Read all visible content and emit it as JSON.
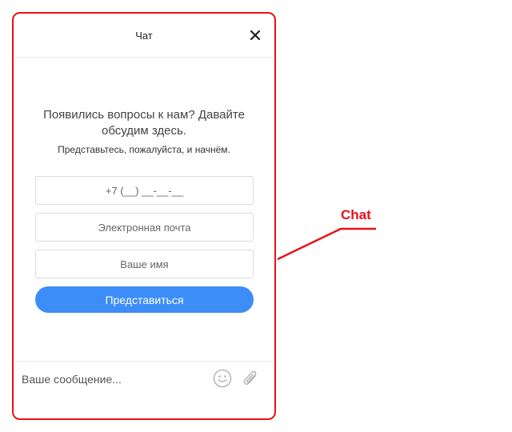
{
  "chat": {
    "title": "Чат",
    "close_icon": "close-icon",
    "intro_question": "Появились вопросы к нам? Давайте обсудим здесь.",
    "intro_hint": "Представьтесь, пожалуйста, и начнём.",
    "phone_placeholder": "+7 (__) __-__-__",
    "email_placeholder": "Электронная почта",
    "name_placeholder": "Ваше имя",
    "submit_label": "Представиться",
    "message_placeholder": "Ваше сообщение...",
    "emoji_icon": "smiley-icon",
    "attach_icon": "paperclip-icon"
  },
  "annotation": {
    "label": "Chat",
    "color": "#e8101a"
  },
  "colors": {
    "accent": "#3c8df7",
    "border_highlight": "#e8101a"
  }
}
